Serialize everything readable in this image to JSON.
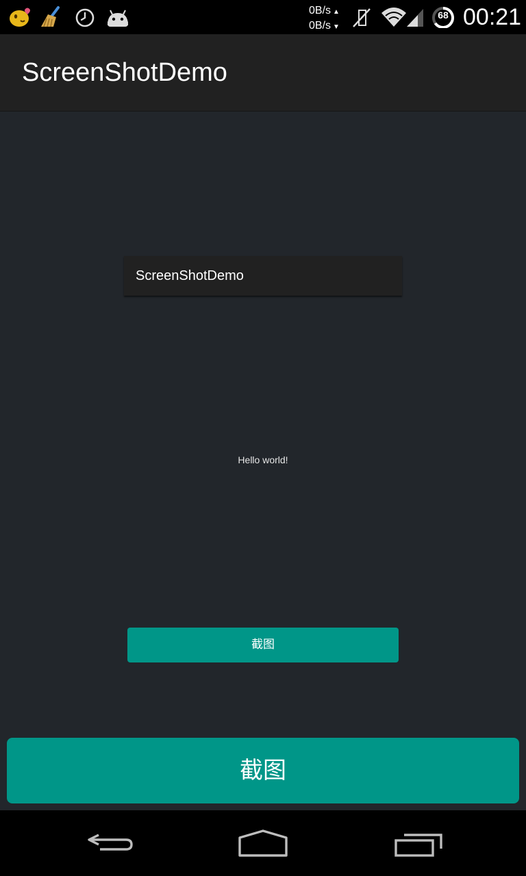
{
  "status_bar": {
    "notification_icons": [
      "emoji-face-icon",
      "broom-icon",
      "clock-icon",
      "android-icon"
    ],
    "speed_up": "0B/s",
    "speed_down": "0B/s",
    "battery_level": "68",
    "time": "00:21"
  },
  "action_bar": {
    "title": "ScreenShotDemo"
  },
  "content": {
    "preview_title": "ScreenShotDemo",
    "hello_text": "Hello world!",
    "capture_button_small": "截图",
    "capture_button_large": "截图"
  },
  "colors": {
    "accent": "#009688",
    "background": "#22262b",
    "action_bar": "#212121"
  },
  "nav_bar": {
    "buttons": [
      "back-icon",
      "home-icon",
      "recents-icon"
    ]
  }
}
